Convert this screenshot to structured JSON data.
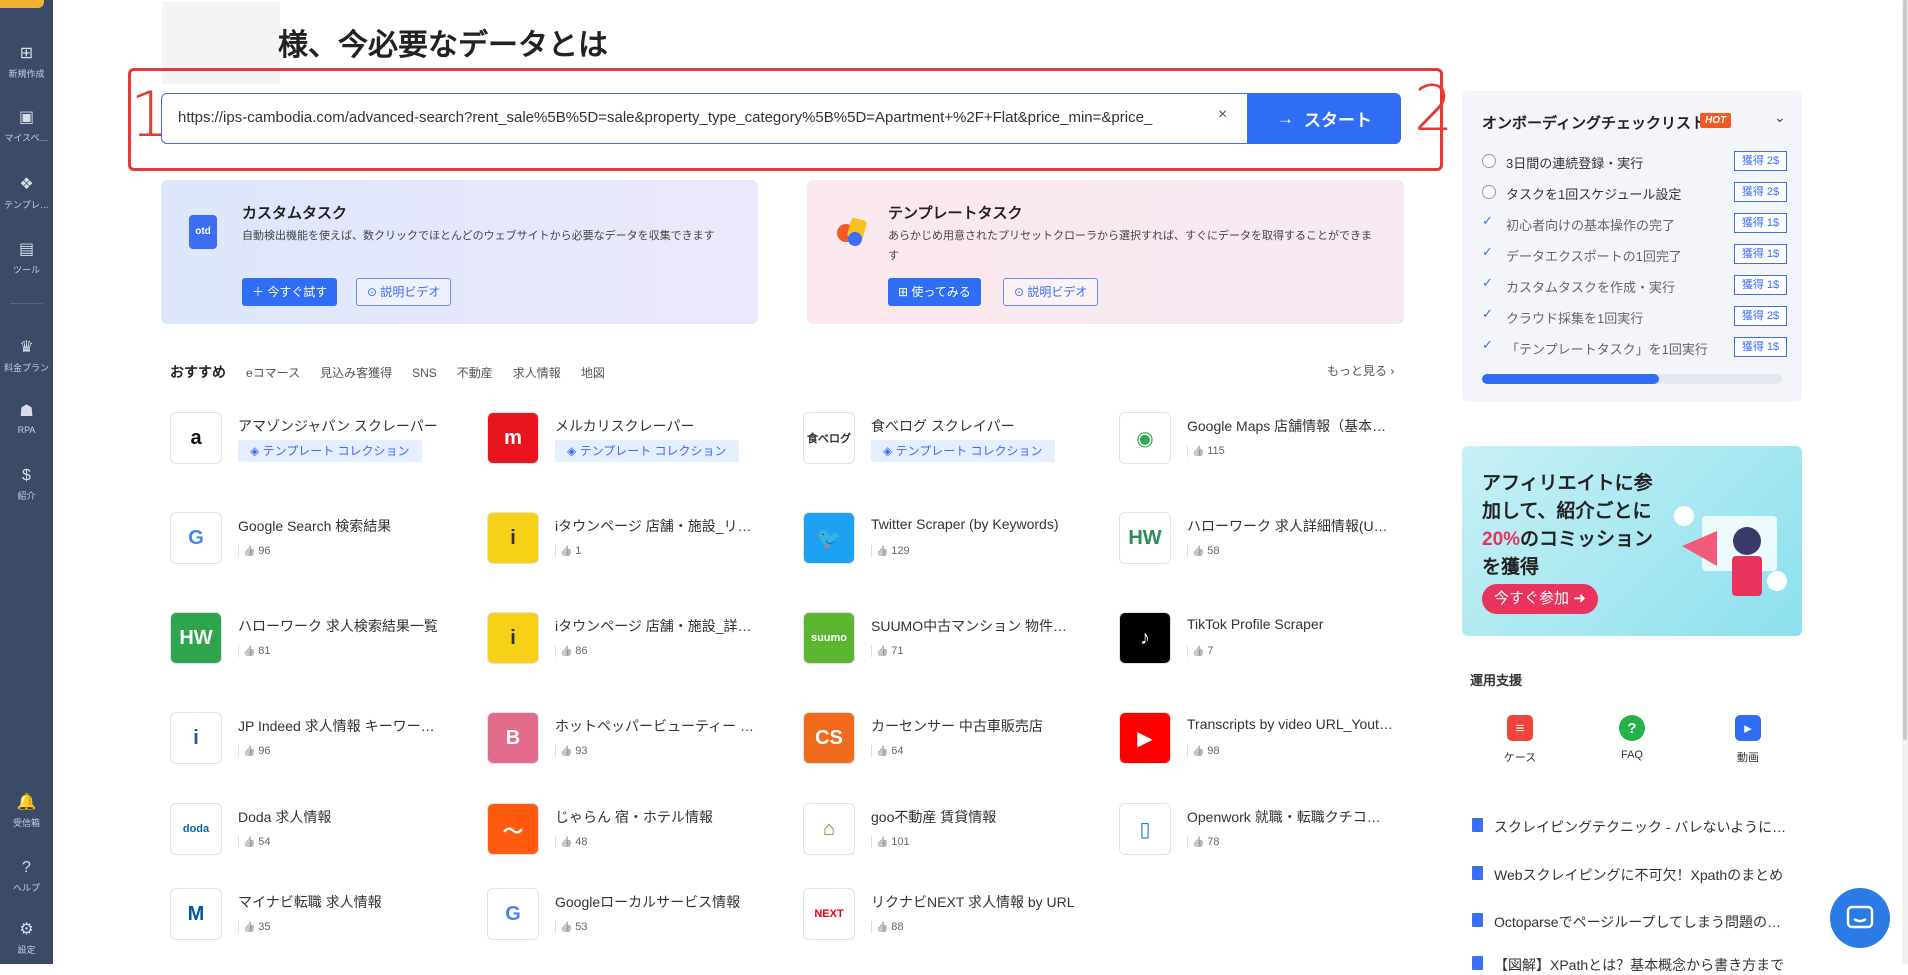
{
  "sidebar": {
    "items": [
      {
        "label": "新規作成",
        "icon": "plus-square-icon"
      },
      {
        "label": "マイスペ…",
        "icon": "bookmark-icon"
      },
      {
        "label": "テンプレ…",
        "icon": "layers-icon"
      },
      {
        "label": "ツール",
        "icon": "toolbox-icon"
      },
      {
        "label": "料金プラン",
        "icon": "crown-icon"
      },
      {
        "label": "RPA",
        "icon": "robot-icon"
      },
      {
        "label": "紹介",
        "icon": "dollar-icon"
      },
      {
        "label": "受信箱",
        "icon": "bell-icon"
      },
      {
        "label": "ヘルプ",
        "icon": "help-icon"
      },
      {
        "label": "設定",
        "icon": "gear-icon"
      }
    ]
  },
  "header": {
    "title": "様、今必要なデータとは"
  },
  "annotations": {
    "one": "1",
    "two": "2"
  },
  "search": {
    "value": "https://ips-cambodia.com/advanced-search?rent_sale%5B%5D=sale&property_type_category%5B%5D=Apartment+%2F+Flat&price_min=&price_",
    "clear": "×",
    "start_label": "スタート"
  },
  "cards": {
    "custom": {
      "title": "カスタムタスク",
      "desc": "自動検出機能を使えば、数クリックでほとんどのウェブサイトから必要なデータを収集できます",
      "btn_primary": "今すぐ試す",
      "btn_secondary": "説明ビデオ"
    },
    "template": {
      "title": "テンプレートタスク",
      "desc": "あらかじめ用意されたプリセットクローラから選択すれば、すぐにデータを取得することができます",
      "btn_primary": "使ってみる",
      "btn_secondary": "説明ビデオ"
    }
  },
  "tabs": [
    "おすすめ",
    "eコマース",
    "見込み客獲得",
    "SNS",
    "不動産",
    "求人情報",
    "地図"
  ],
  "more_link": "もっと見る",
  "templates": [
    {
      "name": "アマゾンジャパン スクレーパー",
      "tag": "テンプレート コレクション",
      "logo": "a",
      "logo_color": "#111111",
      "logo_bg": "#ffffff"
    },
    {
      "name": "メルカリスクレーパー",
      "tag": "テンプレート コレクション",
      "logo": "m",
      "logo_color": "#ffffff",
      "logo_bg": "#e8141e"
    },
    {
      "name": "食べログ スクレイパー",
      "tag": "テンプレート コレクション",
      "logo": "食べログ",
      "logo_color": "#333333",
      "logo_bg": "#ffffff"
    },
    {
      "name": "Google Maps 店舗情報（基本…",
      "likes": "115",
      "logo": "◉",
      "logo_color": "#34a853",
      "logo_bg": "#ffffff"
    },
    {
      "name": "Google Search 検索結果",
      "likes": "96",
      "logo": "G",
      "logo_color": "#4285f4",
      "logo_bg": "#ffffff"
    },
    {
      "name": "iタウンページ 店舗・施設_リ…",
      "likes": "1",
      "logo": "i",
      "logo_color": "#333333",
      "logo_bg": "#f7d117"
    },
    {
      "name": "Twitter Scraper (by Keywords)",
      "likes": "129",
      "logo": "🐦",
      "logo_color": "#ffffff",
      "logo_bg": "#1da1f2"
    },
    {
      "name": "ハローワーク 求人詳細情報(U…",
      "likes": "58",
      "logo": "HW",
      "logo_color": "#2e8b57",
      "logo_bg": "#ffffff"
    },
    {
      "name": "ハローワーク 求人検索結果一覧",
      "likes": "81",
      "logo": "HW",
      "logo_color": "#ffffff",
      "logo_bg": "#2ea44f"
    },
    {
      "name": "iタウンページ 店舗・施設_詳…",
      "likes": "86",
      "logo": "i",
      "logo_color": "#333333",
      "logo_bg": "#f7d117"
    },
    {
      "name": "SUUMO中古マンション 物件…",
      "likes": "71",
      "logo": "suumo",
      "logo_color": "#ffffff",
      "logo_bg": "#5cb531"
    },
    {
      "name": "TikTok Profile Scraper",
      "likes": "7",
      "logo": "♪",
      "logo_color": "#ffffff",
      "logo_bg": "#000000"
    },
    {
      "name": "JP Indeed 求人情報 キーワー…",
      "likes": "96",
      "logo": "i",
      "logo_color": "#2557a7",
      "logo_bg": "#ffffff"
    },
    {
      "name": "ホットペッパービューティー …",
      "likes": "93",
      "logo": "B",
      "logo_color": "#ffffff",
      "logo_bg": "#e26b8b"
    },
    {
      "name": "カーセンサー 中古車販売店",
      "likes": "64",
      "logo": "CS",
      "logo_color": "#ffffff",
      "logo_bg": "#f26b1d"
    },
    {
      "name": "Transcripts by video URL_Yout…",
      "likes": "98",
      "logo": "▶",
      "logo_color": "#ffffff",
      "logo_bg": "#ff0000"
    },
    {
      "name": "Doda 求人情報",
      "likes": "54",
      "logo": "doda",
      "logo_color": "#0068b7",
      "logo_bg": "#ffffff"
    },
    {
      "name": "じゃらん 宿・ホテル情報",
      "likes": "48",
      "logo": "〜",
      "logo_color": "#ffffff",
      "logo_bg": "#ff5a0f"
    },
    {
      "name": "goo不動産 賃貸情報",
      "likes": "101",
      "logo": "⌂",
      "logo_color": "#6b8e23",
      "logo_bg": "#ffffff"
    },
    {
      "name": "Openwork 就職・転職クチコ…",
      "likes": "78",
      "logo": "▯",
      "logo_color": "#1a7fc4",
      "logo_bg": "#ffffff"
    },
    {
      "name": "マイナビ転職 求人情報",
      "likes": "35",
      "logo": "M",
      "logo_color": "#0057a8",
      "logo_bg": "#ffffff"
    },
    {
      "name": "Googleローカルサービス情報",
      "likes": "53",
      "logo": "G",
      "logo_color": "#4285f4",
      "logo_bg": "#ffffff"
    },
    {
      "name": "リクナビNEXT 求人情報 by URL",
      "likes": "88",
      "logo": "NEXT",
      "logo_color": "#e60012",
      "logo_bg": "#ffffff"
    }
  ],
  "onboarding": {
    "title": "オンボーディングチェックリスト",
    "hot": "HOT",
    "items": [
      {
        "text": "3日間の連続登録・実行",
        "reward": "獲得 2$",
        "done": false
      },
      {
        "text": "タスクを1回スケジュール設定",
        "reward": "獲得 2$",
        "done": false
      },
      {
        "text": "初心者向けの基本操作の完了",
        "reward": "獲得 1$",
        "done": true
      },
      {
        "text": "データエクスポートの1回完了",
        "reward": "獲得 1$",
        "done": true
      },
      {
        "text": "カスタムタスクを作成・実行",
        "reward": "獲得 1$",
        "done": true
      },
      {
        "text": "クラウド採集を1回実行",
        "reward": "獲得 2$",
        "done": true
      },
      {
        "text": "「テンプレートタスク」を1回実行",
        "reward": "獲得 1$",
        "done": true
      }
    ],
    "progress": 0.59
  },
  "banner": {
    "line1": "アフィリエイトに参加して、紹介ごとに",
    "highlight": "20%",
    "line2": "のコミッションを獲得",
    "button": "今すぐ参加"
  },
  "support": {
    "title": "運用支援",
    "items": [
      {
        "label": "ケース",
        "color": "#f0443a"
      },
      {
        "label": "FAQ",
        "color": "#22b14c"
      },
      {
        "label": "動画",
        "color": "#2f6df5"
      }
    ]
  },
  "articles": [
    "スクレイピングテクニック - バレないように…",
    "Webスクレイピングに不可欠！Xpathのまとめ",
    "Octoparseでページループしてしまう問題の解…",
    "【図解】XPathとは？基本概念から書き方まで"
  ],
  "colors": {
    "sidebar": "#3b4a67",
    "accent": "#2f6df5",
    "annotation": "#e53935"
  }
}
